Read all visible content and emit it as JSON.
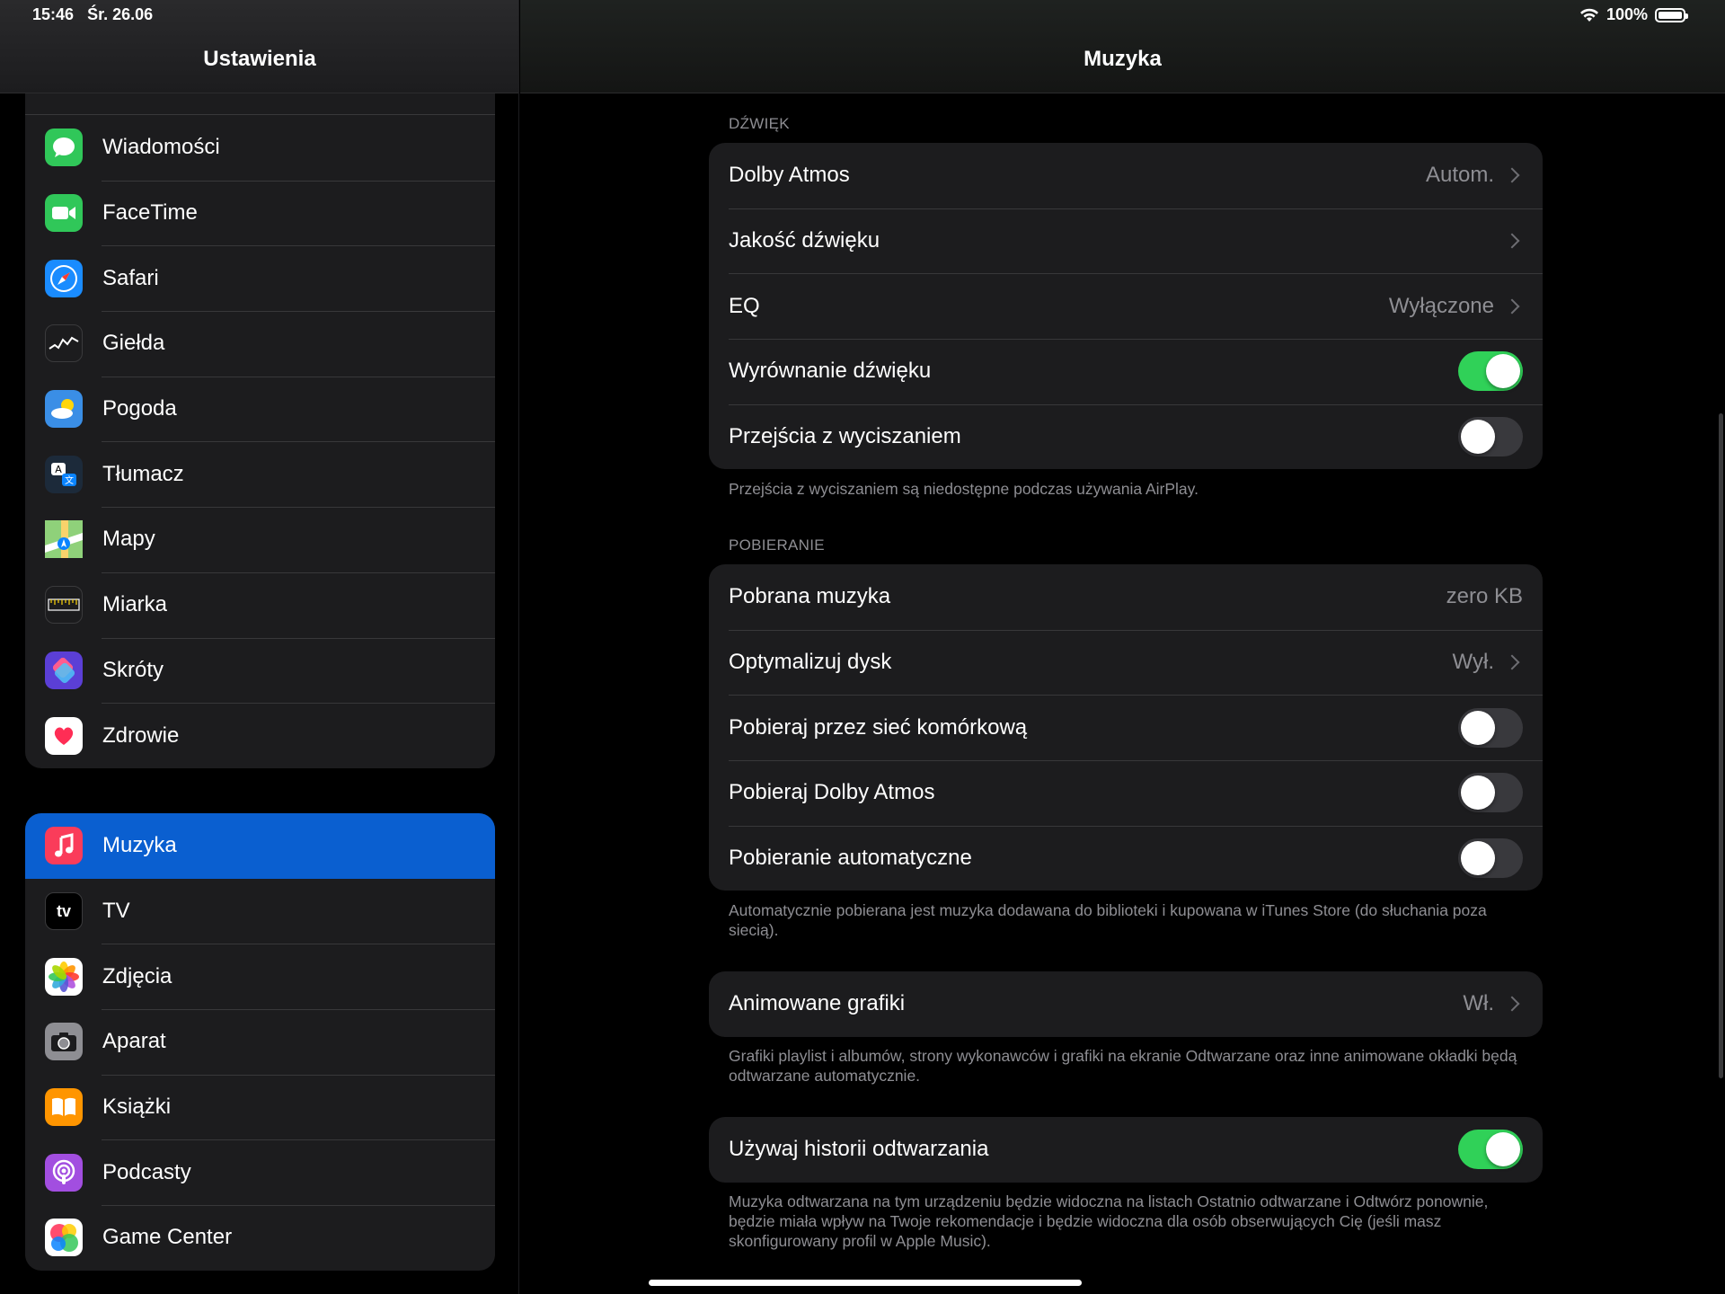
{
  "status": {
    "time": "15:46",
    "date": "Śr. 26.06",
    "battery": "100%"
  },
  "sidebar": {
    "title": "Ustawienia",
    "group1": [
      {
        "label": "Wiadomości",
        "icon": "messages-icon",
        "color": "#30c759"
      },
      {
        "label": "FaceTime",
        "icon": "facetime-icon",
        "color": "#30c759"
      },
      {
        "label": "Safari",
        "icon": "safari-icon",
        "color": "#1a8cff"
      },
      {
        "label": "Giełda",
        "icon": "stocks-icon",
        "color": "#1c1c1e"
      },
      {
        "label": "Pogoda",
        "icon": "weather-icon",
        "color": "#3a8ee6"
      },
      {
        "label": "Tłumacz",
        "icon": "translate-icon",
        "color": "#1c2a3a"
      },
      {
        "label": "Mapy",
        "icon": "maps-icon",
        "color": "#5ac8fa"
      },
      {
        "label": "Miarka",
        "icon": "measure-icon",
        "color": "#1c1c1e"
      },
      {
        "label": "Skróty",
        "icon": "shortcuts-icon",
        "color": "#5b3fd6"
      },
      {
        "label": "Zdrowie",
        "icon": "health-icon",
        "color": "#ffffff"
      }
    ],
    "group2": [
      {
        "label": "Muzyka",
        "icon": "music-icon",
        "color": "#fa3c5a"
      },
      {
        "label": "TV",
        "icon": "tv-icon",
        "color": "#000000"
      },
      {
        "label": "Zdjęcia",
        "icon": "photos-icon",
        "color": "#ffffff"
      },
      {
        "label": "Aparat",
        "icon": "camera-icon",
        "color": "#8e8e93"
      },
      {
        "label": "Książki",
        "icon": "books-icon",
        "color": "#ff9500"
      },
      {
        "label": "Podcasty",
        "icon": "podcasts-icon",
        "color": "#a24ee0"
      },
      {
        "label": "Game Center",
        "icon": "game-center-icon",
        "color": "#ffffff"
      }
    ],
    "icon_glyphs": {
      "tv": "tv",
      "books": "📖",
      "camera": "◉"
    }
  },
  "main": {
    "title": "Muzyka",
    "sound": {
      "header": "DŹWIĘK",
      "dolby": {
        "label": "Dolby Atmos",
        "value": "Autom."
      },
      "quality": {
        "label": "Jakość dźwięku"
      },
      "eq": {
        "label": "EQ",
        "value": "Wyłączone"
      },
      "sound_check": {
        "label": "Wyrównanie dźwięku",
        "on": true
      },
      "crossfade": {
        "label": "Przejścia z wyciszaniem",
        "on": false
      },
      "note": "Przejścia z wyciszaniem są niedostępne podczas używania AirPlay."
    },
    "downloads": {
      "header": "POBIERANIE",
      "downloaded": {
        "label": "Pobrana muzyka",
        "value": "zero KB"
      },
      "optimize": {
        "label": "Optymalizuj dysk",
        "value": "Wył."
      },
      "cellular": {
        "label": "Pobieraj przez sieć komórkową",
        "on": false
      },
      "dolby_dl": {
        "label": "Pobieraj Dolby Atmos",
        "on": false
      },
      "auto": {
        "label": "Pobieranie automatyczne",
        "on": false
      },
      "note": "Automatycznie pobierana jest muzyka dodawana do biblioteki i kupowana w iTunes Store (do słuchania poza siecią)."
    },
    "animated": {
      "label": "Animowane grafiki",
      "value": "Wł.",
      "note": "Grafiki playlist i albumów, strony wykonawców i grafiki na ekranie Odtwarzane oraz inne animowane okładki będą odtwarzane automatycznie."
    },
    "history": {
      "label": "Używaj historii odtwarzania",
      "on": true,
      "note": "Muzyka odtwarzana na tym urządzeniu będzie widoczna na listach Ostatnio odtwarzane i Odtwórz ponownie, będzie miała wpływ na Twoje rekomendacje i będzie widoczna dla osób obserwujących Cię (jeśli masz skonfigurowany profil w Apple Music)."
    }
  }
}
